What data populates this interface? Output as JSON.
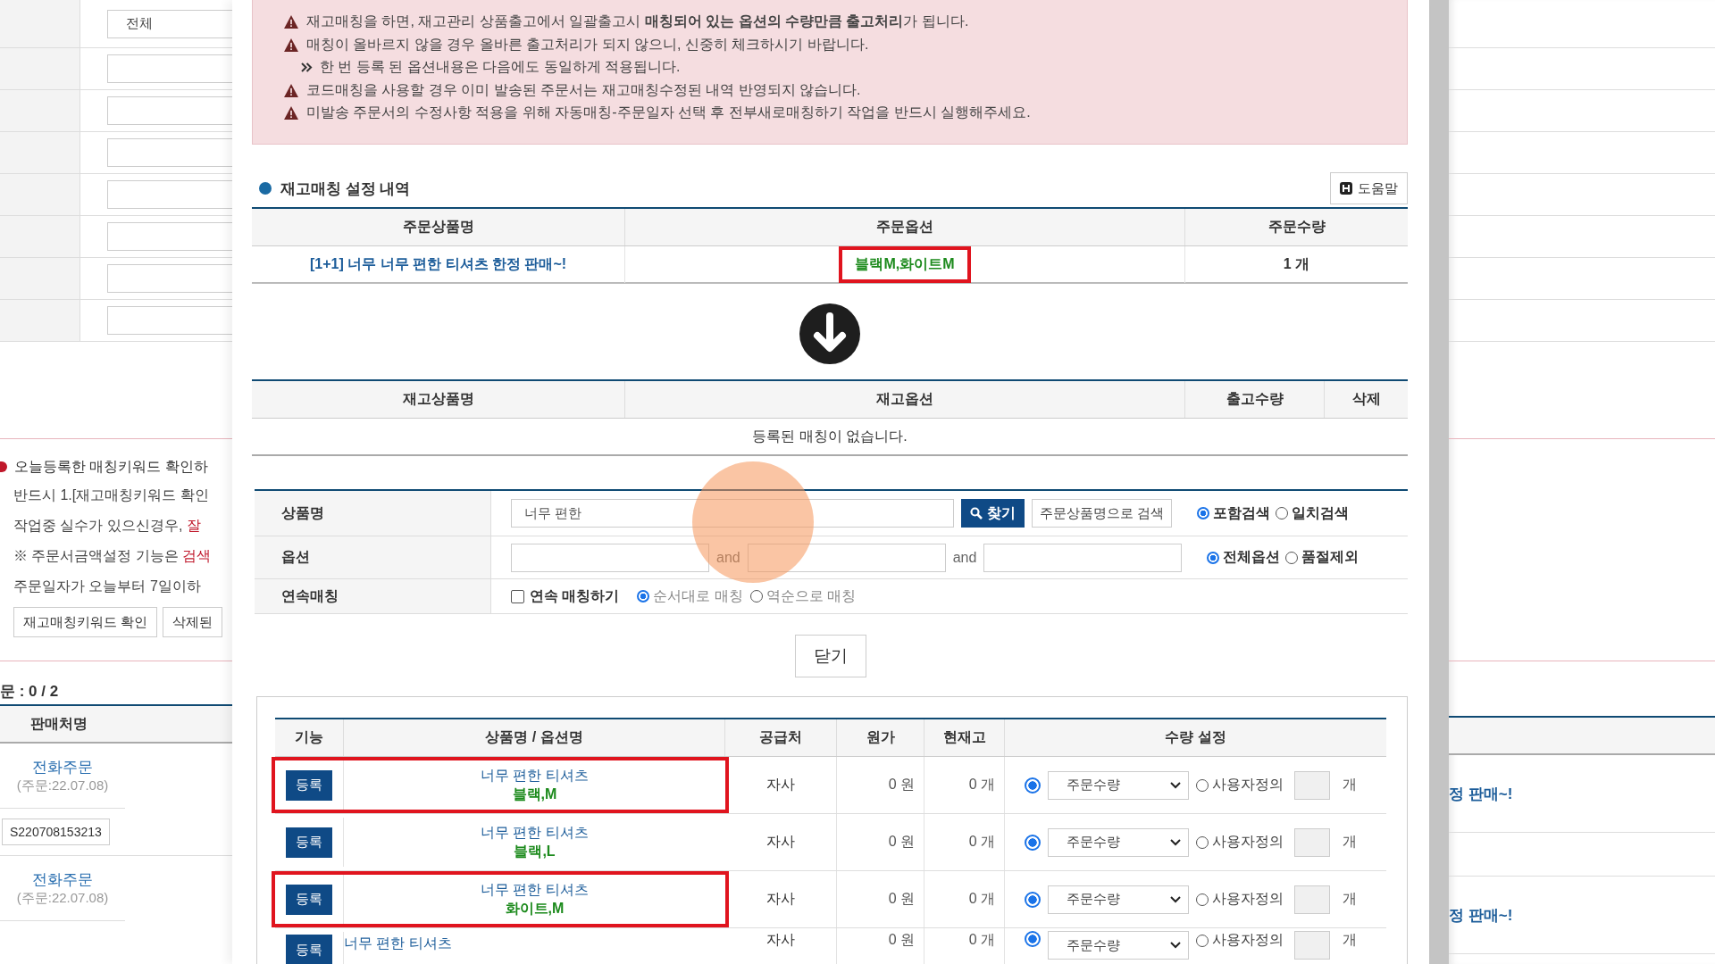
{
  "background_page": {
    "filter_rows": [
      {
        "kind": "field",
        "value": "전체"
      },
      {
        "kind": "field"
      },
      {
        "kind": "field"
      },
      {
        "kind": "field"
      },
      {
        "kind": "field"
      },
      {
        "kind": "field"
      },
      {
        "kind": "field"
      },
      {
        "kind": "field"
      }
    ],
    "notice": {
      "title": "오늘등록한 매칭키워드 확인하",
      "lines": [
        {
          "text": "반드시 1.[재고매칭키워드 확인"
        },
        {
          "text": "작업중 실수가 있으신경우, ",
          "highlight": "잘"
        },
        {
          "text": "※ 주문서금액설정 기능은 ",
          "highlight": "검색"
        },
        {
          "text": "주문일자가 오늘부터 7일이하 "
        }
      ],
      "buttons": [
        "재고매칭키워드 확인",
        "삭제된"
      ]
    },
    "order_count": "문 : 0 / 2",
    "orders_table": {
      "columns": [
        "판매처명"
      ],
      "rows": [
        {
          "kind": "order",
          "seller": "전화주문",
          "date": "(주문:22.07.08)"
        },
        {
          "kind": "code",
          "code": "S220708153213"
        },
        {
          "kind": "order",
          "seller": "전화주문",
          "date": "(주문:22.07.08)"
        }
      ]
    },
    "right_fragments": [
      "정 판매~!",
      "정 판매~!"
    ]
  },
  "modal": {
    "warnings": [
      {
        "kind": "warning",
        "text": "재고매칭을 하면, 재고관리 상품출고에서 일괄출고시 **매칭되어 있는 옵션의 수량만큼 출고처리**가 됩니다."
      },
      {
        "kind": "warning",
        "text": "매칭이 올바르지 않을 경우 올바른 출고처리가 되지 않으니, 신중히 체크하시기 바랍니다."
      },
      {
        "kind": "note",
        "text": "한 번 등록 된 옵션내용은 다음에도 동일하게 적용됩니다."
      },
      {
        "kind": "warning",
        "text": "코드매칭을 사용할 경우 이미 발송된 주문서는 재고매칭수정된 내역 반영되지 않습니다."
      },
      {
        "kind": "warning",
        "text": "미발송 주문서의 수정사항 적용을 위해 자동매칭-주문일자 선택 후 전부새로매칭하기 작업을 반드시 실행해주세요."
      }
    ],
    "section_title": "재고매칭 설정 내역",
    "help_button": "도움말",
    "order_table": {
      "columns": [
        "주문상품명",
        "주문옵션",
        "주문수량"
      ],
      "rows": [
        {
          "product": "[1+1] 너무 너무 편한 티셔츠 한정 판매~!",
          "option": "블랙M,화이트M",
          "option_highlighted": true,
          "quantity": "1 개"
        }
      ]
    },
    "stock_table": {
      "columns": [
        "재고상품명",
        "재고옵션",
        "출고수량",
        "삭제"
      ],
      "empty_message": "등록된 매칭이 없습니다."
    },
    "search_form": {
      "name_label": "상품명",
      "name_value": "너무 편한",
      "find_button": "찾기",
      "order_name_button": "주문상품명으로 검색",
      "name_modes": [
        {
          "label": "포함검색",
          "selected": true
        },
        {
          "label": "일치검색",
          "selected": false
        }
      ],
      "option_label": "옵션",
      "and_labels": [
        "and",
        "and"
      ],
      "option_modes": [
        {
          "label": "전체옵션",
          "selected": true
        },
        {
          "label": "품절제외",
          "selected": false
        }
      ],
      "continuous_label": "연속매칭",
      "continuous_checkbox": {
        "label": "연속 매칭하기",
        "checked": false
      },
      "order_modes": [
        {
          "label": "순서대로 매칭",
          "selected": true,
          "disabled": true
        },
        {
          "label": "역순으로 매칭",
          "selected": false,
          "disabled": true
        }
      ]
    },
    "close_button": "닫기",
    "results_table": {
      "columns": [
        "기능",
        "상품명 / 옵션명",
        "공급처",
        "원가",
        "현재고",
        "수량 설정"
      ],
      "rows": [
        {
          "button": "등록",
          "name": "너무 편한 티셔츠",
          "option": "블랙,M",
          "supplier": "자사",
          "cost": "0 원",
          "stock": "0 개",
          "order_qty_selected": true,
          "qty_select": "주문수량",
          "custom_label": "사용자정의",
          "custom_selected": false,
          "unit": "개",
          "highlighted": true
        },
        {
          "button": "등록",
          "name": "너무 편한 티셔츠",
          "option": "블랙,L",
          "supplier": "자사",
          "cost": "0 원",
          "stock": "0 개",
          "order_qty_selected": true,
          "qty_select": "주문수량",
          "custom_label": "사용자정의",
          "custom_selected": false,
          "unit": "개",
          "highlighted": false
        },
        {
          "button": "등록",
          "name": "너무 편한 티셔츠",
          "option": "화이트,M",
          "supplier": "자사",
          "cost": "0 원",
          "stock": "0 개",
          "order_qty_selected": true,
          "qty_select": "주문수량",
          "custom_label": "사용자정의",
          "custom_selected": false,
          "unit": "개",
          "highlighted": true
        },
        {
          "button": "등록",
          "name": "너무 편한 티셔츠",
          "supplier": "자사",
          "cost": "0 원",
          "stock": "0 개",
          "order_qty_selected": true,
          "qty_select": "주문수량",
          "custom_label": "사용자정의",
          "custom_selected": false,
          "unit": "개",
          "highlighted": false
        }
      ]
    }
  },
  "cursor": {
    "highlight": true
  }
}
